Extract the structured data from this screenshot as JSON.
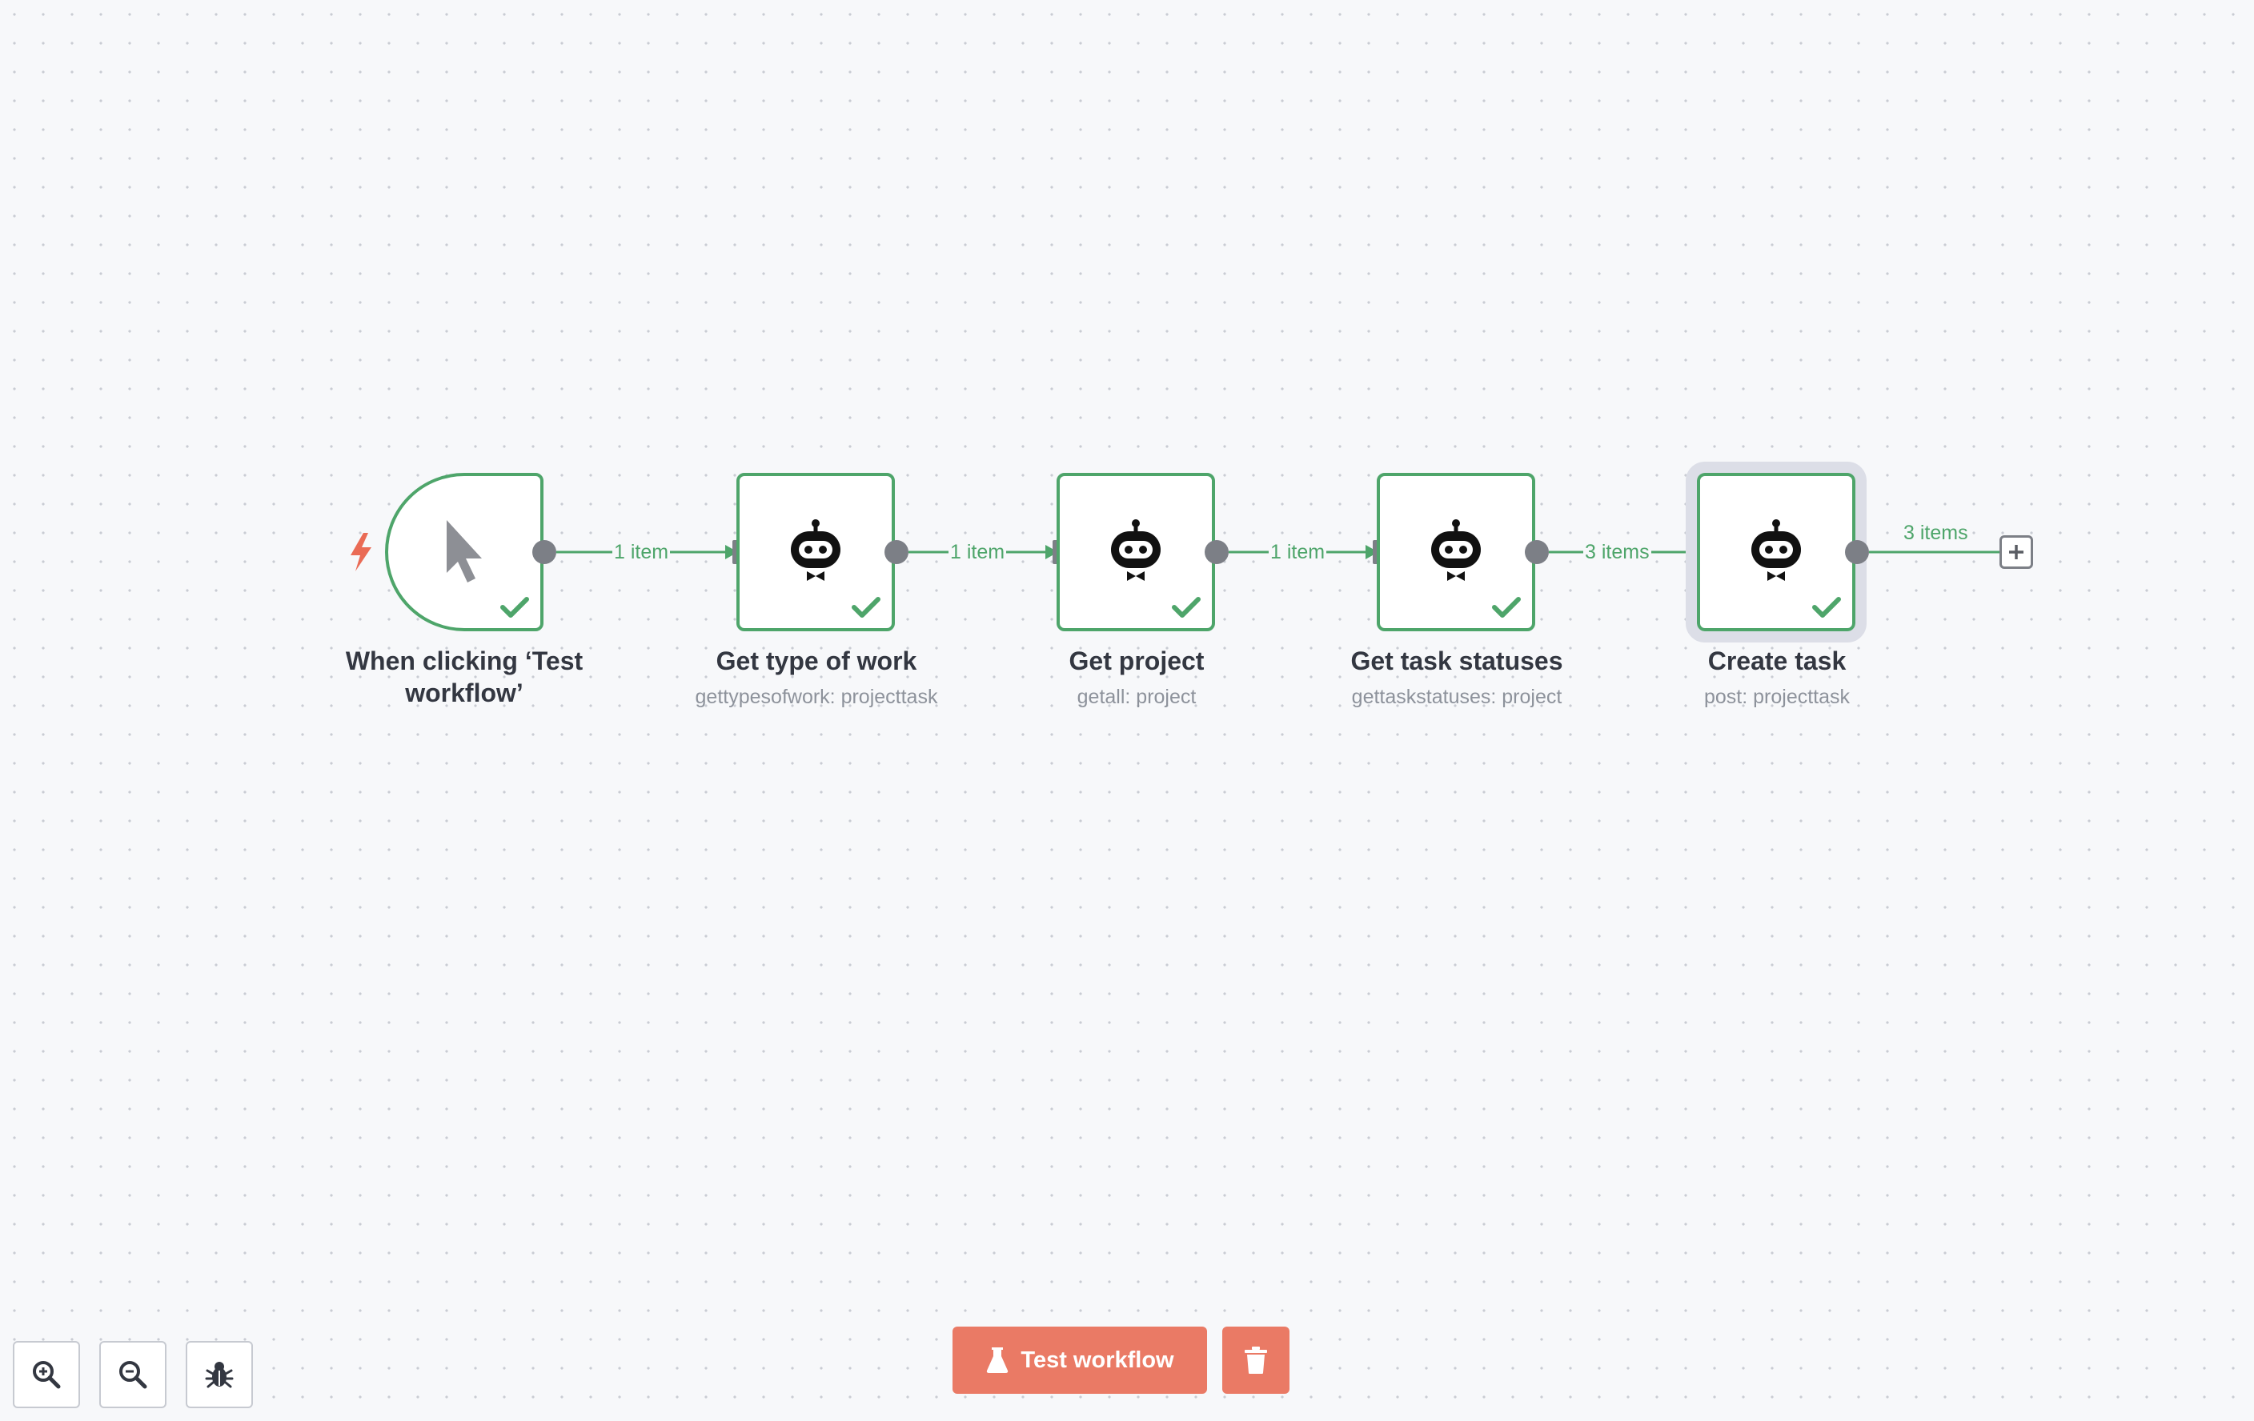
{
  "canvas": {
    "nodes": [
      {
        "id": "trigger",
        "kind": "manual-trigger",
        "title": "When clicking ‘Test workflow’",
        "subtitle": "",
        "icon": "cursor-icon",
        "status": "success"
      },
      {
        "id": "get-type-of-work",
        "kind": "robot",
        "title": "Get type of work",
        "subtitle": "gettypesofwork: projecttask",
        "icon": "robot-icon",
        "status": "success"
      },
      {
        "id": "get-project",
        "kind": "robot",
        "title": "Get project",
        "subtitle": "getall: project",
        "icon": "robot-icon",
        "status": "success"
      },
      {
        "id": "get-task-statuses",
        "kind": "robot",
        "title": "Get task statuses",
        "subtitle": "gettaskstatuses: project",
        "icon": "robot-icon",
        "status": "success"
      },
      {
        "id": "create-task",
        "kind": "robot",
        "title": "Create task",
        "subtitle": "post: projecttask",
        "icon": "robot-icon",
        "status": "success",
        "selected": true
      }
    ],
    "edges": [
      {
        "from": "trigger",
        "to": "get-type-of-work",
        "label": "1 item"
      },
      {
        "from": "get-type-of-work",
        "to": "get-project",
        "label": "1 item"
      },
      {
        "from": "get-project",
        "to": "get-task-statuses",
        "label": "1 item"
      },
      {
        "from": "get-task-statuses",
        "to": "create-task",
        "label": "3 items"
      },
      {
        "from": "create-task",
        "to": "add-node",
        "label": "3 items"
      }
    ]
  },
  "toolbar": {
    "zoom_in_icon": "zoom-in-icon",
    "zoom_out_icon": "zoom-out-icon",
    "debug_icon": "bug-icon"
  },
  "actions": {
    "test_workflow_label": "Test workflow",
    "test_workflow_icon": "flask-icon",
    "delete_icon": "trash-icon"
  },
  "colors": {
    "success": "#4ea56a",
    "handle": "#7c7f86",
    "accent": "#ea7a65",
    "trigger_bolt": "#ea6b55",
    "canvas_bg": "#f7f8fa"
  }
}
